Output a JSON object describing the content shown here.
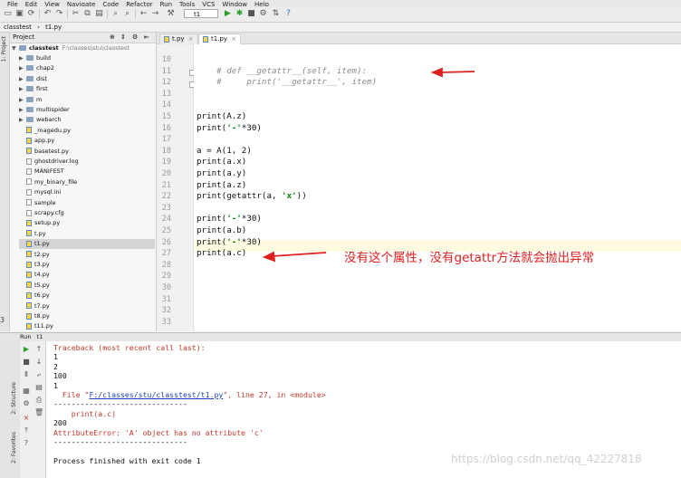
{
  "menu": [
    "File",
    "Edit",
    "View",
    "Navigate",
    "Code",
    "Refactor",
    "Run",
    "Tools",
    "VCS",
    "Window",
    "Help"
  ],
  "toolbar": {
    "run_config": "t1"
  },
  "breadcrumb": [
    "classtest",
    "t1.py"
  ],
  "left_strip": {
    "project_tab": "1: Project"
  },
  "project_panel": {
    "title": "Project",
    "root": "classtest",
    "root_path": "F:\\classes\\stu\\classtest",
    "items": [
      {
        "label": "build",
        "kind": "folder"
      },
      {
        "label": "chap2",
        "kind": "folder"
      },
      {
        "label": "dist",
        "kind": "folder"
      },
      {
        "label": "first",
        "kind": "folder"
      },
      {
        "label": "m",
        "kind": "folder"
      },
      {
        "label": "multispider",
        "kind": "folder"
      },
      {
        "label": "webarch",
        "kind": "folder"
      },
      {
        "label": "_magedu.py",
        "kind": "py"
      },
      {
        "label": "app.py",
        "kind": "py"
      },
      {
        "label": "basetest.py",
        "kind": "py"
      },
      {
        "label": "ghostdriver.log",
        "kind": "file"
      },
      {
        "label": "MANIFEST",
        "kind": "file"
      },
      {
        "label": "my_binary_file",
        "kind": "file"
      },
      {
        "label": "mysql.ini",
        "kind": "file"
      },
      {
        "label": "sample",
        "kind": "file"
      },
      {
        "label": "scrapy.cfg",
        "kind": "file"
      },
      {
        "label": "setup.py",
        "kind": "py"
      },
      {
        "label": "t.py",
        "kind": "py"
      },
      {
        "label": "t1.py",
        "kind": "py",
        "selected": true
      },
      {
        "label": "t2.py",
        "kind": "py"
      },
      {
        "label": "t3.py",
        "kind": "py"
      },
      {
        "label": "t4.py",
        "kind": "py"
      },
      {
        "label": "t5.py",
        "kind": "py"
      },
      {
        "label": "t6.py",
        "kind": "py"
      },
      {
        "label": "t7.py",
        "kind": "py"
      },
      {
        "label": "t8.py",
        "kind": "py"
      },
      {
        "label": "t11.py",
        "kind": "py"
      }
    ]
  },
  "editor": {
    "tabs": [
      {
        "label": "t.py",
        "active": false
      },
      {
        "label": "t1.py",
        "active": true
      }
    ],
    "line_numbers": [
      "10",
      "11",
      "12",
      "13",
      "14",
      "15",
      "16",
      "17",
      "18",
      "19",
      "20",
      "21",
      "22",
      "23",
      "24",
      "25",
      "26",
      "27",
      "28",
      "29",
      "30",
      "31",
      "32",
      "33"
    ],
    "lines": [
      {
        "text": "",
        "comment": false
      },
      {
        "text": "    # def __getattr__(self, item):",
        "comment": true
      },
      {
        "text": "    #     print('__getattr__', item)",
        "comment": true
      },
      {
        "text": "",
        "comment": false
      },
      {
        "text": "",
        "comment": false
      },
      {
        "text": "print(A.z)",
        "comment": false
      },
      {
        "text": "print('-'*30)",
        "comment": false
      },
      {
        "text": "",
        "comment": false
      },
      {
        "text": "a = A(1, 2)",
        "comment": false
      },
      {
        "text": "print(a.x)",
        "comment": false
      },
      {
        "text": "print(a.y)",
        "comment": false
      },
      {
        "text": "print(a.z)",
        "comment": false
      },
      {
        "text": "print(getattr(a, 'x'))",
        "comment": false
      },
      {
        "text": "",
        "comment": false
      },
      {
        "text": "print('-'*30)",
        "comment": false
      },
      {
        "text": "print(a.b)",
        "comment": false
      },
      {
        "text": "print('-'*30)",
        "comment": false
      },
      {
        "text": "print(a.c)",
        "comment": false
      },
      {
        "text": "",
        "comment": false
      },
      {
        "text": "",
        "comment": false
      },
      {
        "text": "",
        "comment": false
      },
      {
        "text": "",
        "comment": false
      },
      {
        "text": "",
        "comment": false
      },
      {
        "text": "",
        "comment": false
      }
    ],
    "annotation": "没有这个属性，没有getattr方法就会抛出异常"
  },
  "run_panel": {
    "title": "Run",
    "config": "t1",
    "side_tabs": [
      "2: Structure",
      "2: Favorites"
    ],
    "console": [
      {
        "text": "Traceback (most recent call last):",
        "err": true
      },
      {
        "text": "1",
        "err": false
      },
      {
        "text": "2",
        "err": false
      },
      {
        "text": "100",
        "err": false
      },
      {
        "text": "1",
        "err": false
      },
      {
        "text": "  File \"F:/classes/stu/classtest/t1.py\", line 27, in <module>",
        "err": true
      },
      {
        "text": "------------------------------",
        "err": false
      },
      {
        "text": "    print(a.c)",
        "err": true
      },
      {
        "text": "200",
        "err": false
      },
      {
        "text": "AttributeError: 'A' object has no attribute 'c'",
        "err": true
      },
      {
        "text": "------------------------------",
        "err": false
      },
      {
        "text": "",
        "err": false
      },
      {
        "text": "Process finished with exit code 1",
        "err": false
      }
    ]
  },
  "watermark": "https://blog.csdn.net/qq_42227818",
  "colors": {
    "annotation": "#e02020",
    "error_text": "#c0392b",
    "string": "#008000",
    "comment": "#8c8c8c"
  }
}
